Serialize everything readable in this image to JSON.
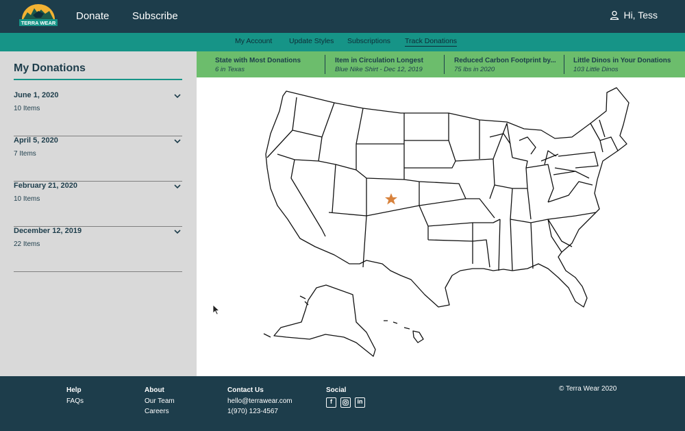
{
  "brand": {
    "logo_text": "TERRA WEAR"
  },
  "header": {
    "nav": [
      "Donate",
      "Subscribe"
    ],
    "user_greeting": "Hi, Tess"
  },
  "subnav": [
    "My Account",
    "Update Styles",
    "Subscriptions",
    "Track Donations"
  ],
  "sidebar": {
    "title": "My Donations",
    "donations": [
      {
        "date": "June 1, 2020",
        "count": "10 Items"
      },
      {
        "date": "April 5, 2020",
        "count": "7 Items"
      },
      {
        "date": "February 21, 2020",
        "count": "10 Items"
      },
      {
        "date": "December 12, 2019",
        "count": "22 Items"
      }
    ]
  },
  "stats": [
    {
      "label": "State with Most Donations",
      "value": "6 in Texas"
    },
    {
      "label": "Item in Circulation Longest",
      "value": "Blue Nike Shirt - Dec 12, 2019"
    },
    {
      "label": "Reduced Carbon Footprint by...",
      "value": "75 lbs in 2020"
    },
    {
      "label": "Little Dinos in Your Donations",
      "value": "103 Little Dinos"
    }
  ],
  "map": {
    "marker_state": "Colorado",
    "marker_color": "#d8823c"
  },
  "footer": {
    "help": {
      "heading": "Help",
      "links": [
        "FAQs"
      ]
    },
    "about": {
      "heading": "About",
      "links": [
        "Our Team",
        "Careers"
      ]
    },
    "contact": {
      "heading": "Contact Us",
      "email": "hello@terrawear.com",
      "phone": "1(970) 123-4567"
    },
    "social": {
      "heading": "Social",
      "icons": [
        "facebook-icon",
        "instagram-icon",
        "linkedin-icon"
      ]
    },
    "copyright": "© Terra Wear 2020"
  },
  "colors": {
    "header_bg": "#1d3d4b",
    "subnav_bg": "#169487",
    "stats_bg": "#6cbd6c",
    "sidebar_bg": "#d9d9d9"
  }
}
